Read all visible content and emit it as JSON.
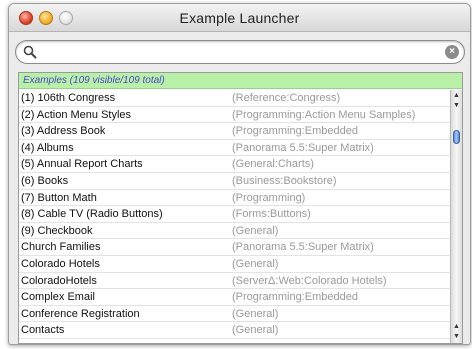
{
  "window": {
    "title": "Example Launcher"
  },
  "search": {
    "value": "",
    "placeholder": ""
  },
  "list": {
    "header": "Examples (109 visible/109 total)",
    "rows": [
      {
        "name": "(1) 106th Congress",
        "category": "(Reference:Congress)"
      },
      {
        "name": "(2) Action Menu Styles",
        "category": "(Programming:Action Menu Samples)"
      },
      {
        "name": "(3) Address Book",
        "category": "(Programming:Embedded"
      },
      {
        "name": "(4) Albums",
        "category": "(Panorama 5.5:Super Matrix)"
      },
      {
        "name": "(5) Annual Report Charts",
        "category": "(General:Charts)"
      },
      {
        "name": "(6) Books",
        "category": "(Business:Bookstore)"
      },
      {
        "name": "(7) Button Math",
        "category": "(Programming)"
      },
      {
        "name": "(8) Cable TV (Radio Buttons)",
        "category": "(Forms:Buttons)"
      },
      {
        "name": "(9) Checkbook",
        "category": "(General)"
      },
      {
        "name": "Church Families",
        "category": "(Panorama 5.5:Super Matrix)"
      },
      {
        "name": "Colorado Hotels",
        "category": "(General)"
      },
      {
        "name": "ColoradoHotels",
        "category": "(ServerΔ:Web:Colorado Hotels)"
      },
      {
        "name": "Complex Email",
        "category": "(Programming:Embedded"
      },
      {
        "name": "Conference Registration",
        "category": "(General)"
      },
      {
        "name": "Contacts",
        "category": "(General)"
      }
    ]
  },
  "scroll": {
    "position_fraction": 0.09
  }
}
